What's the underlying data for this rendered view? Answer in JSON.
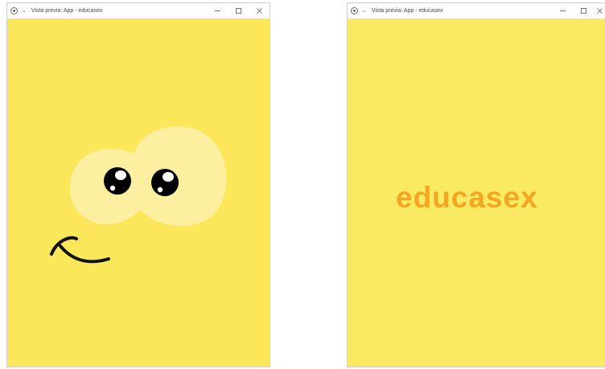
{
  "windows": [
    {
      "title": "Vista previa: App - educasex",
      "controls": {
        "minimize": "–",
        "maximize": "☐",
        "close": "✕"
      }
    },
    {
      "title": "Vista previa: App - educasex",
      "controls": {
        "minimize": "–",
        "maximize": "☐",
        "close": "✕"
      },
      "brand_text": "educasex"
    }
  ],
  "colors": {
    "left_background": "#fbe759",
    "right_background": "#f9ea62",
    "blob": "#fcefa3",
    "brand": "#f6a523",
    "eye": "#000000"
  },
  "icons": [
    "app-icon",
    "chevron-down-icon",
    "minimize-icon",
    "maximize-icon",
    "close-icon"
  ]
}
